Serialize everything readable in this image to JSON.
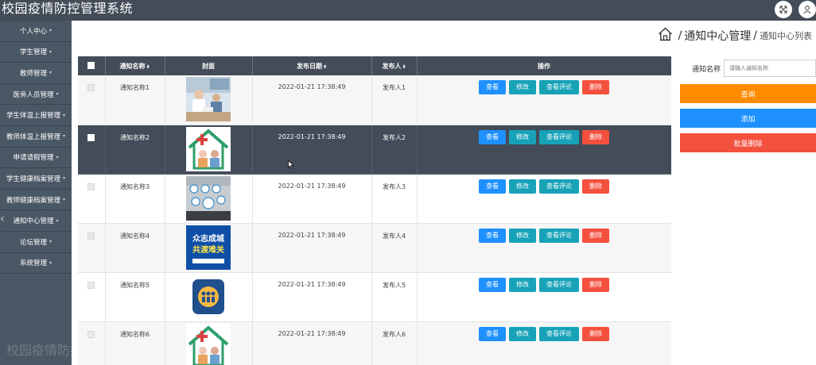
{
  "app": {
    "title": "校园疫情防控管理系统"
  },
  "topbar": {
    "icons": [
      "fullscreen-icon",
      "user-icon"
    ]
  },
  "sidebar": {
    "items": [
      {
        "label": "个人中心"
      },
      {
        "label": "学生管理"
      },
      {
        "label": "教师管理"
      },
      {
        "label": "医务人员管理"
      },
      {
        "label": "学生体温上报管理"
      },
      {
        "label": "教师体温上报管理"
      },
      {
        "label": "申请请假管理"
      },
      {
        "label": "学生健康档案管理"
      },
      {
        "label": "教师健康档案管理"
      },
      {
        "label": "通知中心管理"
      },
      {
        "label": "论坛管理"
      },
      {
        "label": "系统管理"
      }
    ],
    "caret": "▾",
    "collapse": "‹"
  },
  "watermark": "校园疫情防控管理系统",
  "breadcrumb": {
    "main": "通知中心管理",
    "sep1": "/",
    "sep2": "/",
    "sub": "通知中心列表"
  },
  "table": {
    "headers": {
      "name": "通知名称",
      "cover": "封面",
      "date": "发布日期",
      "publisher": "发布人",
      "ops": "操作"
    },
    "sort_icon": "⬍",
    "rows": [
      {
        "name": "通知名称1",
        "date": "2022-01-21 17:38:49",
        "publisher": "发布人1",
        "cover": "photo-meeting"
      },
      {
        "name": "通知名称2",
        "date": "2022-01-21 17:38:49",
        "publisher": "发布人2",
        "cover": "house-medical"
      },
      {
        "name": "通知名称3",
        "date": "2022-01-21 17:38:49",
        "publisher": "发布人3",
        "cover": "medical-icons"
      },
      {
        "name": "通知名称4",
        "date": "2022-01-21 17:38:49",
        "publisher": "发布人4",
        "cover": "poster-blue"
      },
      {
        "name": "通知名称5",
        "date": "2022-01-21 17:38:49",
        "publisher": "发布人5",
        "cover": "family-badge"
      },
      {
        "name": "通知名称6",
        "date": "2022-01-21 17:38:49",
        "publisher": "发布人6",
        "cover": "house-medical"
      }
    ],
    "poster_text_1": "众志成城",
    "poster_text_2": "共渡难关",
    "actions": {
      "view": "查看",
      "edit": "修改",
      "comment": "查看评论",
      "delete": "删除"
    }
  },
  "search": {
    "label": "通知名称",
    "placeholder": "请输入通知名称",
    "value": ""
  },
  "buttons": {
    "search": "查询",
    "add": "添加",
    "bulk_delete": "批量删除"
  },
  "colors": {
    "topbar": "#434c58",
    "sidebar": "#4a5764",
    "view": "#1e90ff",
    "edit": "#17a2b8",
    "delete": "#f4503e",
    "search": "#ff8c00"
  }
}
